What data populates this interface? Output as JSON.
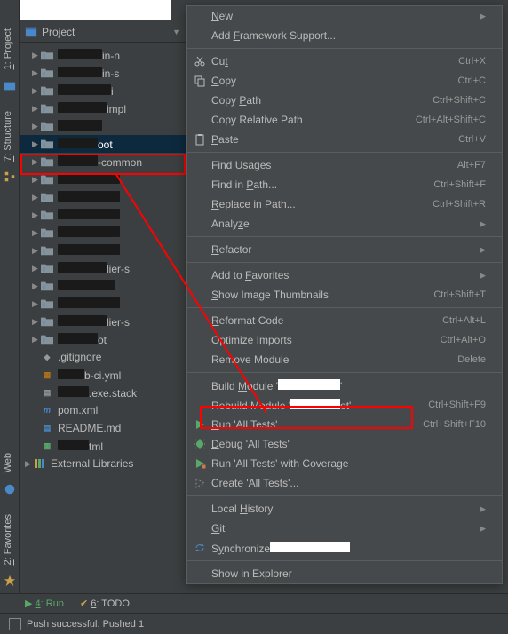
{
  "sidebar": {
    "tabs": [
      {
        "num": "1",
        "label": "Project"
      },
      {
        "num": "7",
        "label": "Structure"
      },
      {
        "num": "",
        "label": "Web"
      },
      {
        "num": "2",
        "label": "Favorites"
      }
    ]
  },
  "treeHeader": {
    "label": "Project"
  },
  "tree": {
    "items": [
      {
        "type": "folder",
        "redactW": 50,
        "suffix": "in-n"
      },
      {
        "type": "folder",
        "redactW": 50,
        "suffix": "in-s"
      },
      {
        "type": "folder",
        "redactW": 60,
        "suffix": "i"
      },
      {
        "type": "folder",
        "redactW": 55,
        "suffix": "impl"
      },
      {
        "type": "folder",
        "redactW": 50,
        "suffix": ""
      },
      {
        "type": "folder",
        "redactW": 45,
        "suffix": "oot",
        "selected": true
      },
      {
        "type": "folder",
        "redactW": 45,
        "suffix": "-common"
      },
      {
        "type": "folder",
        "redactW": 70,
        "suffix": ""
      },
      {
        "type": "folder",
        "redactW": 70,
        "suffix": ""
      },
      {
        "type": "folder",
        "redactW": 70,
        "suffix": ""
      },
      {
        "type": "folder",
        "redactW": 70,
        "suffix": ""
      },
      {
        "type": "folder",
        "redactW": 70,
        "suffix": ""
      },
      {
        "type": "folder",
        "redactW": 55,
        "suffix": "lier-s"
      },
      {
        "type": "folder",
        "redactW": 65,
        "suffix": ""
      },
      {
        "type": "folder",
        "redactW": 70,
        "suffix": ""
      },
      {
        "type": "folder",
        "redactW": 55,
        "suffix": "lier-s"
      },
      {
        "type": "folder",
        "redactW": 45,
        "suffix": "ot"
      },
      {
        "type": "file",
        "icon": "git",
        "label": ".gitignore"
      },
      {
        "type": "file",
        "icon": "yml",
        "label": "b-ci.yml",
        "redactPrefix": 30
      },
      {
        "type": "file",
        "icon": "txt",
        "label": ".exe.stack",
        "redactPrefix": 35
      },
      {
        "type": "file",
        "icon": "m",
        "label": "pom.xml"
      },
      {
        "type": "file",
        "icon": "md",
        "label": "README.md"
      },
      {
        "type": "file",
        "icon": "html",
        "label": "tml",
        "redactPrefix": 35
      },
      {
        "type": "lib",
        "label": "External Libraries"
      }
    ]
  },
  "bottomBar": {
    "run": {
      "num": "4",
      "label": "Run"
    },
    "todo": {
      "num": "6",
      "label": "TODO"
    }
  },
  "statusBar": {
    "label": "Push successful: Pushed 1"
  },
  "menu": [
    {
      "kind": "item",
      "label": "New",
      "mn": "N",
      "sub": true
    },
    {
      "kind": "item",
      "label": "Add Framework Support...",
      "mn": "F"
    },
    {
      "kind": "sep"
    },
    {
      "kind": "item",
      "icon": "cut",
      "label": "Cut",
      "mn": "t",
      "shortcut": "Ctrl+X"
    },
    {
      "kind": "item",
      "icon": "copy",
      "label": "Copy",
      "mn": "C",
      "shortcut": "Ctrl+C"
    },
    {
      "kind": "item",
      "label": "Copy Path",
      "mn": "P",
      "shortcut": "Ctrl+Shift+C"
    },
    {
      "kind": "item",
      "label": "Copy Relative Path",
      "shortcut": "Ctrl+Alt+Shift+C"
    },
    {
      "kind": "item",
      "icon": "paste",
      "label": "Paste",
      "mn": "P",
      "shortcut": "Ctrl+V"
    },
    {
      "kind": "sep"
    },
    {
      "kind": "item",
      "label": "Find Usages",
      "mn": "U",
      "shortcut": "Alt+F7"
    },
    {
      "kind": "item",
      "label": "Find in Path...",
      "mn": "P",
      "shortcut": "Ctrl+Shift+F"
    },
    {
      "kind": "item",
      "label": "Replace in Path...",
      "mn": "R",
      "shortcut": "Ctrl+Shift+R"
    },
    {
      "kind": "item",
      "label": "Analyze",
      "mn": "z",
      "sub": true
    },
    {
      "kind": "sep"
    },
    {
      "kind": "item",
      "label": "Refactor",
      "mn": "R",
      "sub": true
    },
    {
      "kind": "sep"
    },
    {
      "kind": "item",
      "label": "Add to Favorites",
      "mn": "F",
      "sub": true
    },
    {
      "kind": "item",
      "label": "Show Image Thumbnails",
      "mn": "S",
      "shortcut": "Ctrl+Shift+T"
    },
    {
      "kind": "sep"
    },
    {
      "kind": "item",
      "label": "Reformat Code",
      "mn": "R",
      "shortcut": "Ctrl+Alt+L"
    },
    {
      "kind": "item",
      "label": "Optimize Imports",
      "mn": "z",
      "shortcut": "Ctrl+Alt+O"
    },
    {
      "kind": "item",
      "label": "Remove Module",
      "shortcut": "Delete"
    },
    {
      "kind": "sep"
    },
    {
      "kind": "item",
      "label": "Build Module '",
      "mn": "M",
      "whiteRedact": 70,
      "tail": "'"
    },
    {
      "kind": "item",
      "label": "Rebuild Module '",
      "mn": "E",
      "whiteRedact": 56,
      "tail": "ot'",
      "shortcut": "Ctrl+Shift+F9"
    },
    {
      "kind": "item",
      "icon": "run",
      "label": "Run 'All Tests'",
      "mn": "R",
      "shortcut": "Ctrl+Shift+F10"
    },
    {
      "kind": "item",
      "icon": "debug",
      "label": "Debug 'All Tests'",
      "mn": "D"
    },
    {
      "kind": "item",
      "icon": "coverage",
      "label": "Run 'All Tests' with Coverage"
    },
    {
      "kind": "item",
      "icon": "create",
      "label": "Create 'All Tests'..."
    },
    {
      "kind": "sep"
    },
    {
      "kind": "item",
      "label": "Local History",
      "mn": "H",
      "sub": true
    },
    {
      "kind": "item",
      "label": "Git",
      "mn": "G",
      "sub": true
    },
    {
      "kind": "item",
      "icon": "sync",
      "label": "Synchronize",
      "mn": "y",
      "whiteRedact": 90
    },
    {
      "kind": "sep"
    },
    {
      "kind": "item",
      "label": "Show in Explorer"
    }
  ]
}
